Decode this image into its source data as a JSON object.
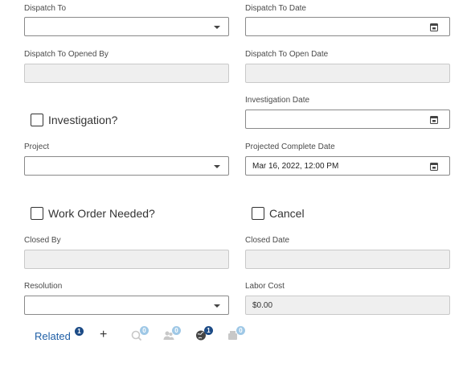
{
  "fields": {
    "dispatch_to": {
      "label": "Dispatch To",
      "value": ""
    },
    "dispatch_to_date": {
      "label": "Dispatch To Date",
      "value": ""
    },
    "dispatch_to_opened_by": {
      "label": "Dispatch To Opened By",
      "value": ""
    },
    "dispatch_to_open_date": {
      "label": "Dispatch To Open Date",
      "value": ""
    },
    "investigation_date": {
      "label": "Investigation Date",
      "value": ""
    },
    "project": {
      "label": "Project",
      "value": ""
    },
    "projected_complete_date": {
      "label": "Projected Complete Date",
      "value": "Mar 16, 2022, 12:00 PM"
    },
    "closed_by": {
      "label": "Closed By",
      "value": ""
    },
    "closed_date": {
      "label": "Closed Date",
      "value": ""
    },
    "resolution": {
      "label": "Resolution",
      "value": ""
    },
    "labor_cost": {
      "label": "Labor Cost",
      "value": "$0.00"
    }
  },
  "checkboxes": {
    "investigation": {
      "label": "Investigation?",
      "checked": false
    },
    "work_order_needed": {
      "label": "Work Order Needed?",
      "checked": false
    },
    "cancel": {
      "label": "Cancel",
      "checked": false
    }
  },
  "toolbar": {
    "related_label": "Related",
    "related_count": "1",
    "add_symbol": "+",
    "icons": [
      {
        "name": "search-related-icon",
        "count": "0",
        "style": "light"
      },
      {
        "name": "people-icon",
        "count": "0",
        "style": "light"
      },
      {
        "name": "globe-icon",
        "count": "1",
        "style": "dark"
      },
      {
        "name": "box-icon",
        "count": "0",
        "style": "light"
      }
    ]
  },
  "colors": {
    "accent": "#1f5fa6",
    "badge_dark": "#1c4b86",
    "badge_light": "#9fc8e6"
  }
}
